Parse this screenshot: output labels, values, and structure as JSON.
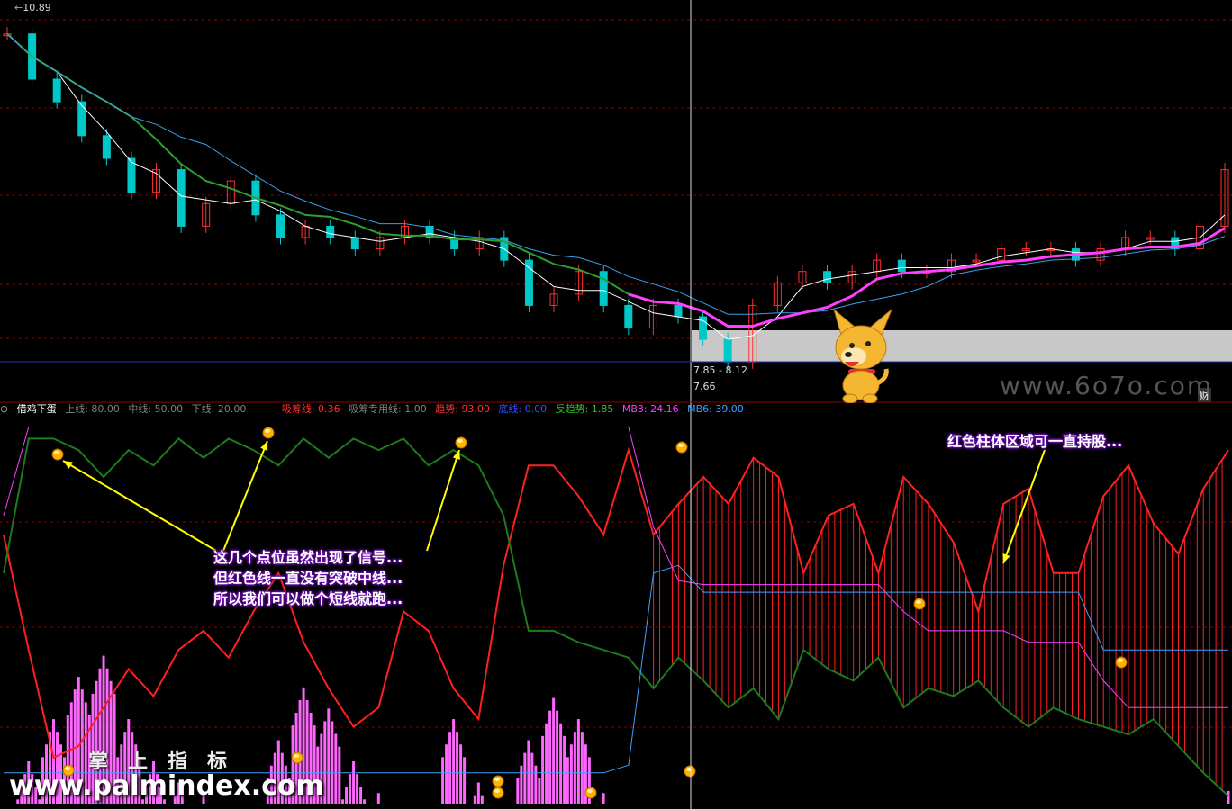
{
  "price_panel": {
    "high_label": "10.89",
    "price_range_label": "7.85 - 8.12",
    "low_label": "7.66",
    "fin_badge": "财"
  },
  "indicator_header": {
    "name": "借鸡下蛋",
    "params": [
      {
        "text": "上线: 80.00",
        "color": "#808080"
      },
      {
        "text": "中线: 50.00",
        "color": "#808080"
      },
      {
        "text": "下线: 20.00",
        "color": "#808080"
      },
      {
        "text": "吸筹线: 0.36",
        "color": "#ff3030"
      },
      {
        "text": "吸筹专用线: 1.00",
        "color": "#808080"
      },
      {
        "text": "趋势: 93.00",
        "color": "#ff3030"
      },
      {
        "text": "底线: 0.00",
        "color": "#3050ff"
      },
      {
        "text": "反趋势: 1.85",
        "color": "#30c030"
      },
      {
        "text": "MB3: 24.16",
        "color": "#ff40ff"
      },
      {
        "text": "MB6: 39.00",
        "color": "#40a0ff"
      }
    ]
  },
  "annotations": {
    "left_lines": [
      "这几个点位虽然出现了信号...",
      "但红色线一直没有突破中线...",
      "所以我们可以做个短线就跑..."
    ],
    "right_text": "红色柱体区域可一直持股..."
  },
  "watermarks": {
    "site": "www.6o7o.com",
    "cn": "掌上指标",
    "url": "www.palmindex.com"
  },
  "colors": {
    "up": "#ff3030",
    "down": "#00c8c8",
    "ma_short": "#ffffff",
    "ma_green": "#2e9e2e",
    "ma_blue": "#3aa0e8",
    "ma_magenta": "#ff40ff",
    "trend": "#ff2020",
    "anti_trend": "#1e7a1e",
    "mb3": "#ff40ff",
    "mb6": "#40a0ff",
    "accumulation": "#ff66ff",
    "grid": "#8b0000"
  },
  "chart_data": [
    {
      "type": "candlestick",
      "title": "",
      "y_ticks_visible": [
        "10.89"
      ],
      "price_samples": [
        10.7,
        10.3,
        10.1,
        9.8,
        9.6,
        9.3,
        9.5,
        9.0,
        9.2,
        9.4,
        9.1,
        8.9,
        9.0,
        8.9,
        8.8,
        8.9,
        9.0,
        8.9,
        8.8,
        8.9,
        8.7,
        8.3,
        8.4,
        8.6,
        8.3,
        8.1,
        8.3,
        8.2,
        8.0,
        7.8,
        8.3,
        8.5,
        8.6,
        8.5,
        8.6,
        8.7,
        8.6,
        8.6,
        8.7,
        8.7,
        8.8,
        8.8,
        8.8,
        8.7,
        8.8,
        8.9,
        8.9,
        8.8,
        9.0,
        9.5
      ],
      "annotations": [
        "7.85 - 8.12",
        "7.66"
      ]
    },
    {
      "type": "line",
      "title": "借鸡下蛋",
      "reference_lines": [
        80,
        50,
        20
      ],
      "series": [
        {
          "name": "趋势",
          "values": [
            70,
            40,
            12,
            15,
            25,
            35,
            28,
            40,
            45,
            38,
            50,
            60,
            42,
            30,
            20,
            25,
            50,
            45,
            30,
            22,
            62,
            88,
            88,
            80,
            70,
            92,
            70,
            78,
            85,
            78,
            90,
            85,
            60,
            75,
            78,
            60,
            85,
            78,
            68,
            50,
            78,
            82,
            60,
            60,
            80,
            88,
            73,
            65,
            82,
            92
          ]
        },
        {
          "name": "反趋势",
          "values": [
            60,
            95,
            95,
            92,
            85,
            92,
            88,
            95,
            90,
            95,
            92,
            88,
            95,
            90,
            95,
            92,
            95,
            88,
            92,
            88,
            75,
            45,
            45,
            42,
            40,
            38,
            30,
            38,
            32,
            25,
            30,
            22,
            40,
            35,
            32,
            38,
            25,
            30,
            28,
            32,
            25,
            20,
            25,
            22,
            20,
            18,
            22,
            15,
            8,
            2
          ]
        },
        {
          "name": "MB3",
          "values": [
            75,
            98,
            98,
            98,
            98,
            98,
            98,
            98,
            98,
            98,
            98,
            98,
            98,
            98,
            98,
            98,
            98,
            98,
            98,
            98,
            98,
            98,
            98,
            98,
            98,
            98,
            72,
            58,
            57,
            57,
            57,
            57,
            57,
            57,
            57,
            57,
            50,
            45,
            45,
            45,
            45,
            42,
            42,
            42,
            32,
            25,
            25,
            25,
            25,
            25
          ]
        },
        {
          "name": "MB6",
          "values": [
            8,
            8,
            8,
            8,
            8,
            8,
            8,
            8,
            8,
            8,
            8,
            8,
            8,
            8,
            8,
            8,
            8,
            8,
            8,
            8,
            8,
            8,
            8,
            8,
            8,
            10,
            60,
            62,
            55,
            55,
            55,
            55,
            55,
            55,
            55,
            55,
            55,
            55,
            55,
            55,
            55,
            55,
            55,
            55,
            40,
            40,
            40,
            40,
            40,
            40
          ]
        }
      ]
    }
  ]
}
